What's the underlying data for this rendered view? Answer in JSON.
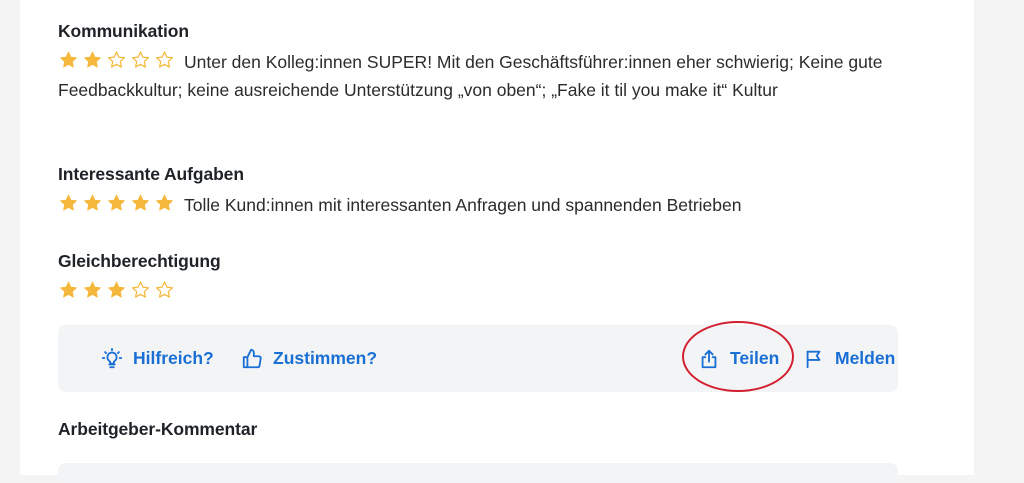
{
  "ratings": [
    {
      "title": "Kommunikation",
      "stars": 2,
      "max_stars": 5,
      "text": "Unter den Kolleg:innen SUPER! Mit den Geschäftsführer:innen eher schwierig; Keine gute Feedbackkultur; keine ausreichende Unterstützung „von oben“; „Fake it til you make it“ Kultur"
    },
    {
      "title": "Interessante Aufgaben",
      "stars": 5,
      "max_stars": 5,
      "text": "Tolle Kund:innen mit interessanten Anfragen und spannenden Betrieben"
    },
    {
      "title": "Gleichberechtigung",
      "stars": 3,
      "max_stars": 5,
      "text": ""
    }
  ],
  "actions": {
    "helpful_label": "Hilfreich?",
    "agree_label": "Zustimmen?",
    "share_label": "Teilen",
    "report_label": "Melden"
  },
  "employer_comment_heading": "Arbeitgeber-Kommentar",
  "colors": {
    "star_filled": "#f5b83d",
    "star_outline": "#f5b83d",
    "action_blue": "#1a6fd4",
    "highlight_red": "#d32030"
  }
}
